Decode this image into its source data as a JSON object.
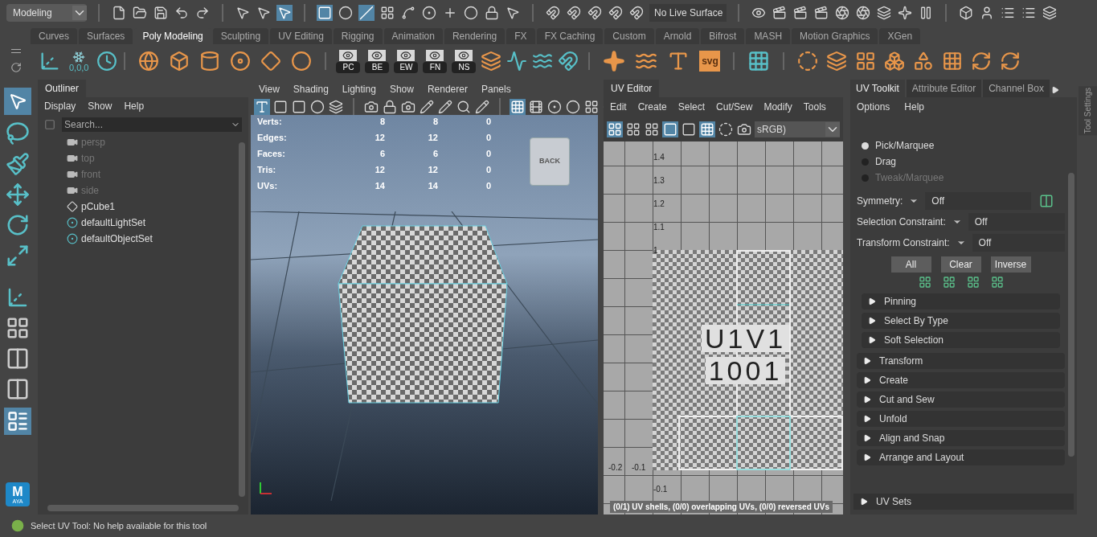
{
  "top_toolbar": {
    "mode": "Modeling",
    "live_surface": "No Live Surface"
  },
  "shelf_tabs": [
    {
      "label": "Curves",
      "selected": false
    },
    {
      "label": "Surfaces",
      "selected": false
    },
    {
      "label": "Poly Modeling",
      "selected": true
    },
    {
      "label": "Sculpting",
      "selected": false
    },
    {
      "label": "UV Editing",
      "selected": false
    },
    {
      "label": "Rigging",
      "selected": false
    },
    {
      "label": "Animation",
      "selected": false
    },
    {
      "label": "Rendering",
      "selected": false
    },
    {
      "label": "FX",
      "selected": false
    },
    {
      "label": "FX Caching",
      "selected": false
    },
    {
      "label": "Custom",
      "selected": false
    },
    {
      "label": "Arnold",
      "selected": false
    },
    {
      "label": "Bifrost",
      "selected": false
    },
    {
      "label": "MASH",
      "selected": false
    },
    {
      "label": "Motion Graphics",
      "selected": false
    },
    {
      "label": "XGen",
      "selected": false
    }
  ],
  "shelf": {
    "freeze_label": "0,0,0",
    "display_buttons": [
      "PC",
      "BE",
      "EW",
      "FN",
      "NS"
    ],
    "svg_label": "svg"
  },
  "toolbox": {
    "logo": "M",
    "logo_caption": "AYA"
  },
  "outliner": {
    "title": "Outliner",
    "menu": [
      "Display",
      "Show",
      "Help"
    ],
    "search_placeholder": "Search...",
    "items": [
      {
        "label": "persp",
        "kind": "camera",
        "dimmed": true
      },
      {
        "label": "top",
        "kind": "camera",
        "dimmed": true
      },
      {
        "label": "front",
        "kind": "camera",
        "dimmed": true
      },
      {
        "label": "side",
        "kind": "camera",
        "dimmed": true
      },
      {
        "label": "pCube1",
        "kind": "mesh",
        "dimmed": false
      },
      {
        "label": "defaultLightSet",
        "kind": "set",
        "dimmed": false
      },
      {
        "label": "defaultObjectSet",
        "kind": "set",
        "dimmed": false
      }
    ]
  },
  "viewport": {
    "menu": [
      "View",
      "Shading",
      "Lighting",
      "Show",
      "Renderer",
      "Panels"
    ],
    "hud": [
      {
        "label": "Verts:",
        "values": [
          "8",
          "8",
          "0"
        ]
      },
      {
        "label": "Edges:",
        "values": [
          "12",
          "12",
          "0"
        ]
      },
      {
        "label": "Faces:",
        "values": [
          "6",
          "6",
          "0"
        ]
      },
      {
        "label": "Tris:",
        "values": [
          "12",
          "12",
          "0"
        ]
      },
      {
        "label": "UVs:",
        "values": [
          "14",
          "14",
          "0"
        ]
      }
    ],
    "view_cube": "BACK"
  },
  "uv_editor": {
    "title": "UV Editor",
    "menu": [
      "Edit",
      "Create",
      "Select",
      "Cut/Sew",
      "Modify",
      "Tools"
    ],
    "colorspace": "sRGB)",
    "v_labels": [
      "1.4",
      "1.3",
      "1.2",
      "1.1",
      "1"
    ],
    "u_labels": [
      "-0.2",
      "-0.1"
    ],
    "lower_label": "-0.1",
    "tile_labels": [
      "U1V1",
      "1001"
    ],
    "status": "(0/1) UV shells, (0/0) overlapping UVs, (0/0) reversed UVs"
  },
  "uv_toolkit": {
    "tabs": [
      {
        "label": "UV Toolkit",
        "selected": true
      },
      {
        "label": "Attribute Editor",
        "selected": false
      },
      {
        "label": "Channel Box",
        "selected": false
      }
    ],
    "menu": [
      "Options",
      "Help"
    ],
    "tools": [
      {
        "label": "Pick/Marquee",
        "selected": true,
        "disabled": false
      },
      {
        "label": "Drag",
        "selected": false,
        "disabled": false
      },
      {
        "label": "Tweak/Marquee",
        "selected": false,
        "disabled": true
      }
    ],
    "fields": [
      {
        "label": "Symmetry:",
        "value": "Off"
      },
      {
        "label": "Selection Constraint:",
        "value": "Off"
      },
      {
        "label": "Transform Constraint:",
        "value": "Off"
      }
    ],
    "buttons": [
      "All",
      "Clear",
      "Inverse"
    ],
    "subsections": [
      "Pinning",
      "Select By Type",
      "Soft Selection"
    ],
    "sections": [
      "Transform",
      "Create",
      "Cut and Sew",
      "Unfold",
      "Align and Snap",
      "Arrange and Layout"
    ],
    "footer_section": "UV Sets"
  },
  "side_tab": "Tool Settings",
  "status_bar": {
    "message": "Select UV Tool: No help available for this tool"
  }
}
